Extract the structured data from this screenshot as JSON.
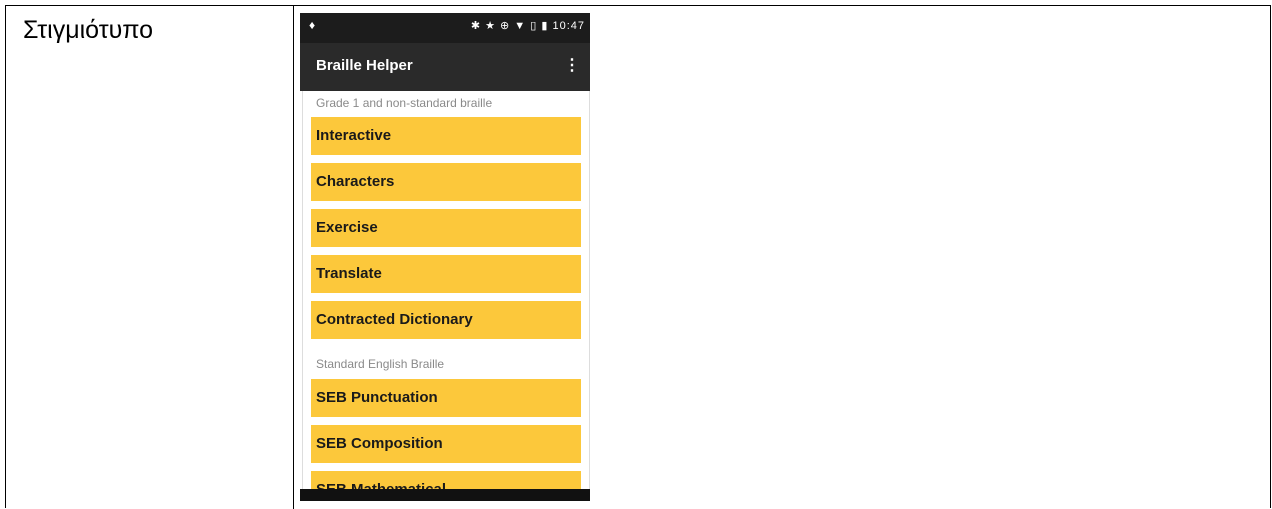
{
  "document": {
    "row_label": "Στιγμιότυπο"
  },
  "phone": {
    "status_bar": {
      "left_icon": "location-pin-icon",
      "right_icons": "✱ ★ ⊕ ▼ ▯ ▮",
      "time": "10:47"
    },
    "app_bar": {
      "title": "Braille Helper",
      "menu_icon": "overflow-menu-icon"
    },
    "sections": [
      {
        "header": "Grade 1 and non-standard braille",
        "items": [
          "Interactive",
          "Characters",
          "Exercise",
          "Translate",
          "Contracted Dictionary"
        ]
      },
      {
        "header": "Standard English Braille",
        "items": [
          "SEB Punctuation",
          "SEB Composition",
          "SEB Mathematical"
        ]
      }
    ],
    "colors": {
      "item_background": "#fcc83b",
      "app_bar": "#2a2a2a",
      "status_bar": "#1c1c1c"
    }
  }
}
